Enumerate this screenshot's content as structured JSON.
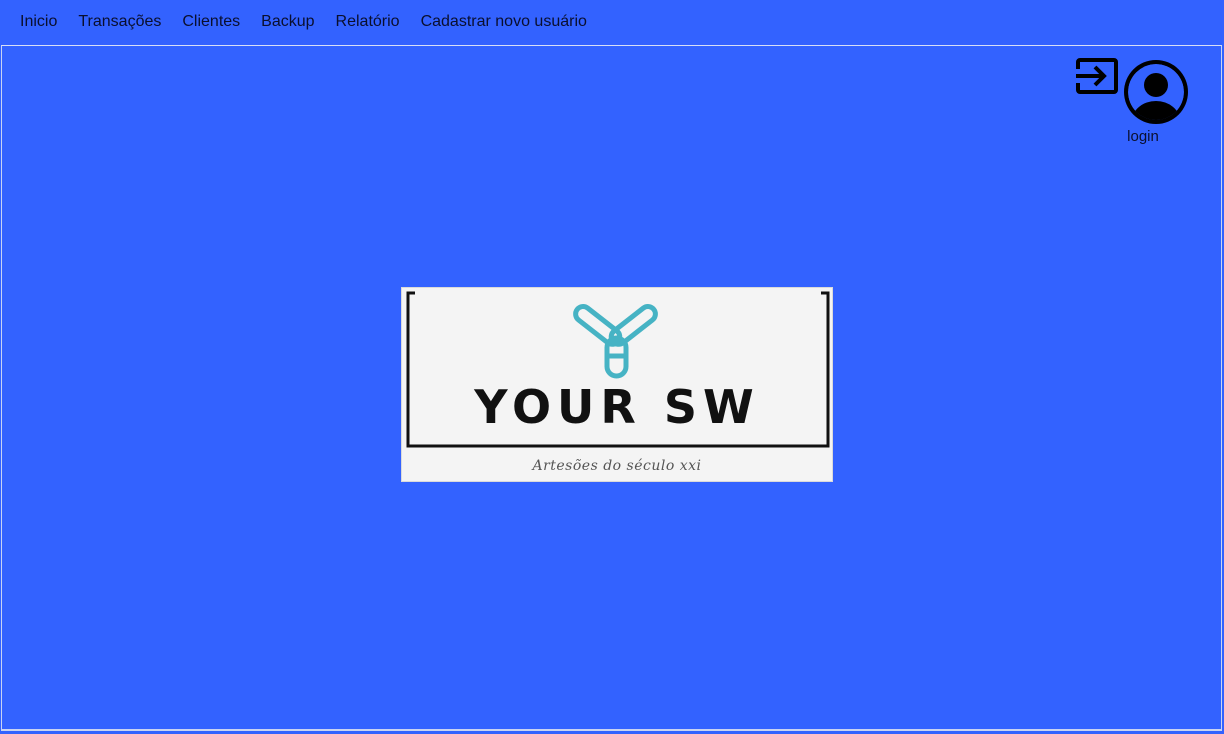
{
  "menu": {
    "items": [
      {
        "label": "Inicio"
      },
      {
        "label": "Transações"
      },
      {
        "label": "Clientes"
      },
      {
        "label": "Backup"
      },
      {
        "label": "Relatório"
      },
      {
        "label": "Cadastrar novo usuário"
      }
    ]
  },
  "user": {
    "login_label": "login",
    "logout_icon": "logout-icon",
    "avatar_icon": "user-avatar-icon"
  },
  "logo": {
    "brand": "YOUR SW",
    "tagline": "Artesões do século xxi",
    "mark_color": "#46b3c4"
  },
  "colors": {
    "background": "#3362ff",
    "text": "#0a0f2e"
  }
}
